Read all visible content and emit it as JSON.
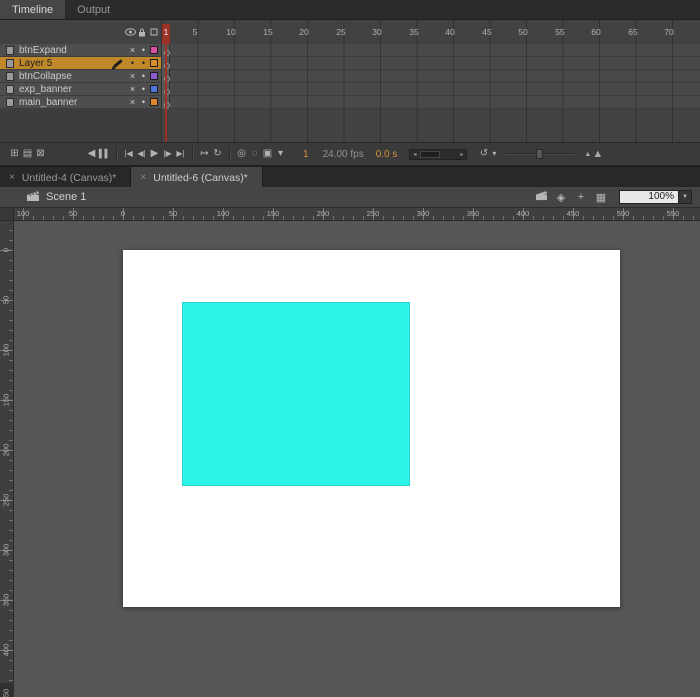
{
  "colors": {
    "selection_orange": "#c08829",
    "playhead_red": "#9c3126",
    "stage_fill": "#2ef4ea"
  },
  "panel_tabs": {
    "timeline": "Timeline",
    "output": "Output"
  },
  "timeline": {
    "frame_numbers": [
      "1",
      "5",
      "10",
      "15",
      "20",
      "25",
      "30",
      "35",
      "40",
      "45",
      "50",
      "55",
      "60",
      "65",
      "70"
    ],
    "layers": [
      {
        "name": "btnExpand",
        "eye": "×",
        "lock": "•",
        "color": "#df4fa5",
        "selected": false
      },
      {
        "name": "Layer 5",
        "eye": "•",
        "lock": "•",
        "color": "#d98e2c",
        "selected": true
      },
      {
        "name": "btnCollapse",
        "eye": "×",
        "lock": "•",
        "color": "#8e5ad0",
        "selected": false
      },
      {
        "name": "exp_banner",
        "eye": "×",
        "lock": "•",
        "color": "#4e78d8",
        "selected": false
      },
      {
        "name": "main_banner",
        "eye": "×",
        "lock": "•",
        "color": "#e0862d",
        "selected": false
      }
    ],
    "status": {
      "current_frame": "1",
      "frame_rate": "24.00 fps",
      "elapsed_time": "0.0 s"
    },
    "icons": {
      "new_layer": "⊞",
      "new_folder": "▤",
      "delete_layer": "⊠",
      "prev_keyframe": "◀",
      "pause": "▌▌",
      "first_frame": "|◀",
      "step_back": "◀|",
      "play": "▶",
      "step_forward": "|▶",
      "last_frame": "▶|",
      "center_frame": "↦",
      "loop": "↻",
      "onion_skin": "◎",
      "onion_outlines": "◌",
      "edit_multiple_frames": "▣",
      "modify_markers": "▾",
      "scroll_left": "◂",
      "scroll_right": "▸",
      "reset_zoom": "↺",
      "caret_down": "▾",
      "zoom_small": "▲",
      "zoom_large": "▲"
    }
  },
  "document_tabs": {
    "close_glyph": "×",
    "tabs": [
      {
        "label": "Untitled-4 (Canvas)*",
        "active": false
      },
      {
        "label": "Untitled-6 (Canvas)*",
        "active": true
      }
    ]
  },
  "edit_bar": {
    "scene_label": "Scene 1",
    "zoom_value": "100%",
    "icons": {
      "edit_symbols": "◈",
      "center_stage": "+",
      "clip_bounds": "▦",
      "caret_down": "▼"
    }
  },
  "rulers": {
    "horizontal": [
      "100",
      "50",
      "0",
      "50",
      "100",
      "150",
      "200",
      "250",
      "300",
      "350",
      "400",
      "450",
      "500",
      "550"
    ],
    "vertical": [
      "0",
      "50",
      "100",
      "150",
      "200",
      "250",
      "300",
      "350",
      "400",
      "450"
    ]
  }
}
